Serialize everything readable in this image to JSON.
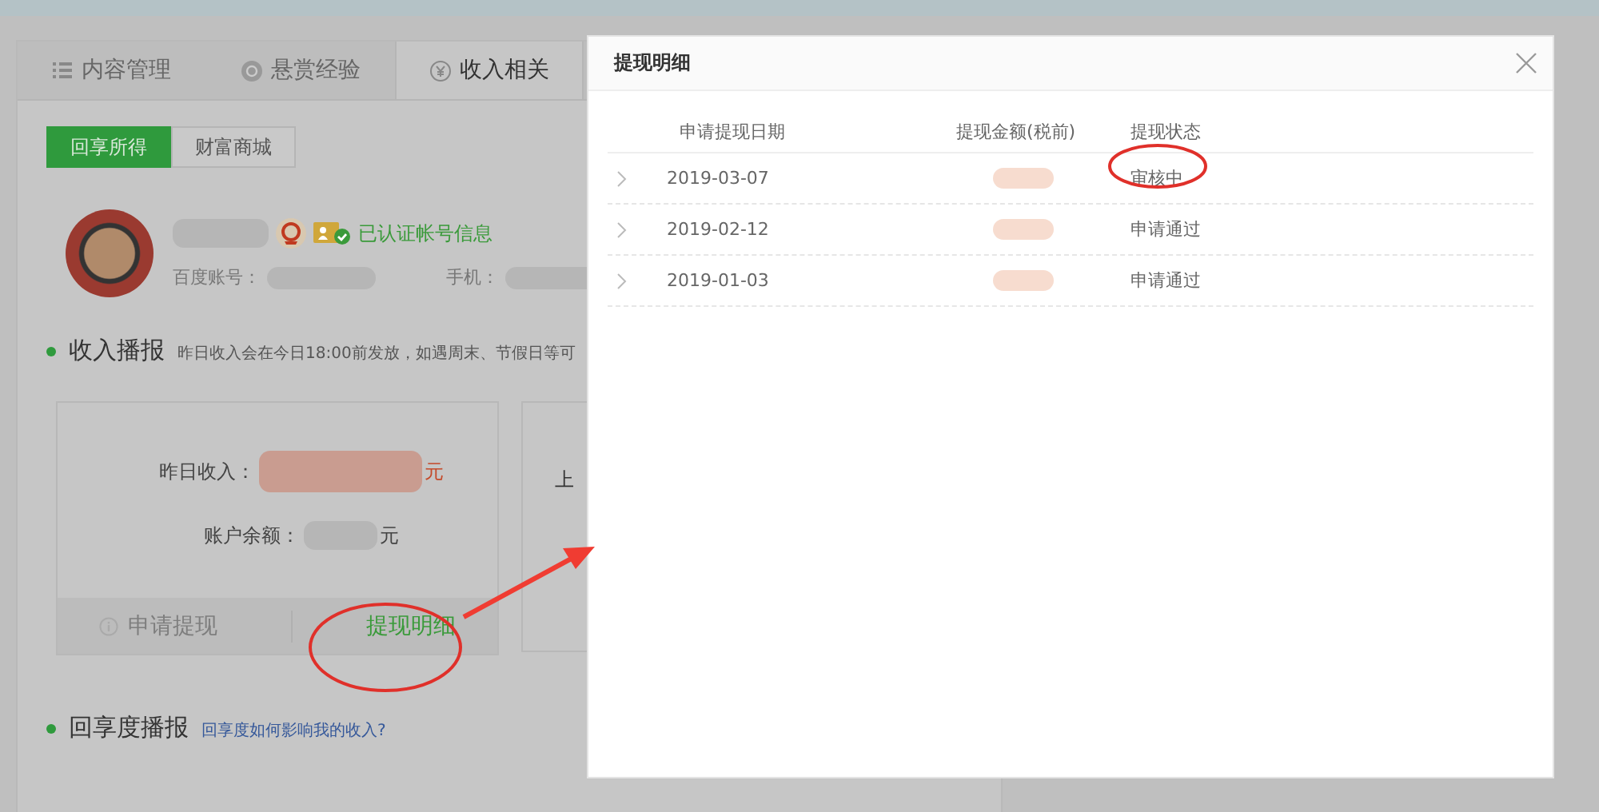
{
  "tabs": [
    {
      "label": "内容管理",
      "selected": false
    },
    {
      "label": "悬赏经验",
      "selected": false
    },
    {
      "label": "收入相关",
      "selected": true
    }
  ],
  "subtabs": [
    {
      "label": "回享所得",
      "selected": true
    },
    {
      "label": "财富商城",
      "selected": false
    }
  ],
  "profile": {
    "verified_label": "已认证帐号信息",
    "account_label": "百度账号：",
    "phone_label": "手机："
  },
  "income_section": {
    "title": "收入播报",
    "note": "昨日收入会在今日18:00前发放，如遇周末、节假日等可"
  },
  "income_card": {
    "lines": [
      {
        "label": "昨日收入：",
        "unit": "元",
        "highlight": true
      },
      {
        "label": "账户余额：",
        "unit": "元",
        "highlight": false
      }
    ],
    "actions": [
      {
        "label": "申请提现",
        "disabled": true
      },
      {
        "label": "提现明细",
        "disabled": false
      }
    ]
  },
  "second_card": {
    "label": "上"
  },
  "score_section": {
    "title": "回享度播报",
    "link": "回享度如何影响我的收入?"
  },
  "dialog": {
    "title": "提现明细",
    "columns": [
      "申请提现日期",
      "提现金额(税前)",
      "提现状态"
    ],
    "rows": [
      {
        "date": "2019-03-07",
        "status": "审核中"
      },
      {
        "date": "2019-02-12",
        "status": "申请通过"
      },
      {
        "date": "2019-01-03",
        "status": "申请通过"
      }
    ]
  }
}
